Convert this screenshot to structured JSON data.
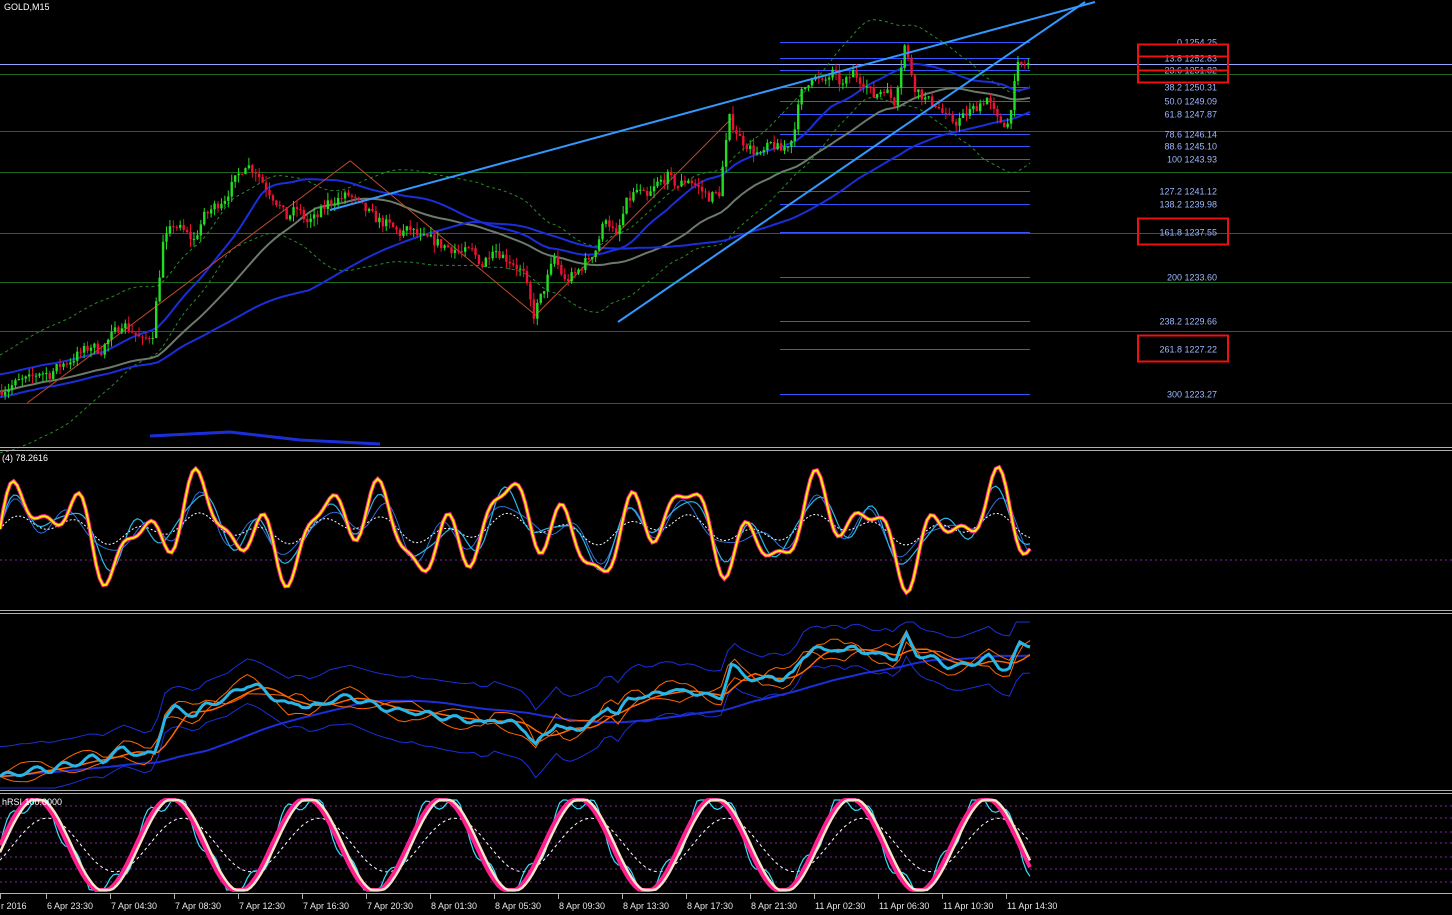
{
  "header": {
    "symbol_label": "GOLD,M15"
  },
  "panes": {
    "rsi_label": "(4) 78.2616",
    "stochrsi_label": "hRSI 100.0000"
  },
  "colors": {
    "background": "#000000",
    "candle_up": "#22dd22",
    "candle_down": "#ee1133",
    "trend_line": "#3399ff",
    "ma_blue": "#1a2fd9",
    "ma_gray": "#6b7a6b",
    "bollinger": "#2a8a2a",
    "fib_line": "#3355ff",
    "highlight_box": "#ee1111",
    "rsi_yellow": "#ffee00",
    "rsi_magenta": "#ff1f8f",
    "rsi_cyan": "#29b6e6",
    "band_orange": "#ff6600",
    "stoch_cream": "#f7e3c8",
    "stoch_cyan": "#33e0ff"
  },
  "chart_data": [
    {
      "type": "candlestick",
      "title": "GOLD,M15",
      "fib_levels": [
        {
          "ratio": "0",
          "price": 1254.25,
          "label": "0 1254.25"
        },
        {
          "ratio": "13.8",
          "price": 1252.83,
          "label": "13.8 1252.83",
          "highlighted": true
        },
        {
          "ratio": "23.6",
          "price": 1251.82,
          "label": "23.6 1251.82",
          "highlighted": true
        },
        {
          "ratio": "38.2",
          "price": 1250.31,
          "label": "38.2 1250.31"
        },
        {
          "ratio": "50.0",
          "price": 1249.09,
          "label": "50.0 1249.09"
        },
        {
          "ratio": "61.8",
          "price": 1247.87,
          "label": "61.8 1247.87"
        },
        {
          "ratio": "78.6",
          "price": 1246.14,
          "label": "78.6 1246.14"
        },
        {
          "ratio": "88.6",
          "price": 1245.1,
          "label": "88.6 1245.10"
        },
        {
          "ratio": "100",
          "price": 1243.93,
          "label": "100 1243.93"
        },
        {
          "ratio": "127.2",
          "price": 1241.12,
          "label": "127.2 1241.12"
        },
        {
          "ratio": "138.2",
          "price": 1239.98,
          "label": "138.2 1239.98"
        },
        {
          "ratio": "161.8",
          "price": 1237.55,
          "label": "161.8 1237.55",
          "highlighted": true
        },
        {
          "ratio": "200",
          "price": 1233.6,
          "label": "200 1233.60"
        },
        {
          "ratio": "238.2",
          "price": 1229.66,
          "label": "238.2 1229.66"
        },
        {
          "ratio": "261.8",
          "price": 1227.22,
          "label": "261.8 1227.22",
          "highlighted": true
        },
        {
          "ratio": "300",
          "price": 1223.27,
          "label": "300 1223.27"
        }
      ],
      "close_path": [
        [
          0,
          1223.5
        ],
        [
          3,
          1223.8
        ],
        [
          6,
          1224.4
        ],
        [
          9,
          1224.6
        ],
        [
          12,
          1225.2
        ],
        [
          15,
          1225.0
        ],
        [
          18,
          1225.8
        ],
        [
          21,
          1226.2
        ],
        [
          24,
          1226.9
        ],
        [
          27,
          1227.5
        ],
        [
          30,
          1227.1
        ],
        [
          33,
          1228.4
        ],
        [
          36,
          1229.5
        ],
        [
          39,
          1228.8
        ],
        [
          42,
          1227.9
        ],
        [
          45,
          1228.6
        ],
        [
          48,
          1236.5
        ],
        [
          51,
          1238.2
        ],
        [
          54,
          1237.6
        ],
        [
          57,
          1236.8
        ],
        [
          60,
          1238.9
        ],
        [
          63,
          1239.8
        ],
        [
          66,
          1240.5
        ],
        [
          69,
          1242.1
        ],
        [
          72,
          1243.5
        ],
        [
          75,
          1242.9
        ],
        [
          78,
          1241.5
        ],
        [
          81,
          1240.2
        ],
        [
          84,
          1238.8
        ],
        [
          87,
          1239.6
        ],
        [
          90,
          1238.4
        ],
        [
          93,
          1238.9
        ],
        [
          96,
          1240.1
        ],
        [
          99,
          1240.4
        ],
        [
          102,
          1240.8
        ],
        [
          105,
          1240.0
        ],
        [
          108,
          1239.2
        ],
        [
          111,
          1238.5
        ],
        [
          114,
          1238.1
        ],
        [
          117,
          1237.4
        ],
        [
          120,
          1237.8
        ],
        [
          123,
          1237.0
        ],
        [
          126,
          1236.9
        ],
        [
          129,
          1236.4
        ],
        [
          132,
          1236.1
        ],
        [
          135,
          1235.7
        ],
        [
          138,
          1235.9
        ],
        [
          141,
          1234.6
        ],
        [
          144,
          1236.2
        ],
        [
          147,
          1235.4
        ],
        [
          150,
          1234.8
        ],
        [
          153,
          1233.8
        ],
        [
          156,
          1230.2
        ],
        [
          159,
          1232.6
        ],
        [
          162,
          1235.3
        ],
        [
          165,
          1233.2
        ],
        [
          168,
          1233.8
        ],
        [
          171,
          1234.9
        ],
        [
          174,
          1236.0
        ],
        [
          177,
          1238.9
        ],
        [
          180,
          1237.0
        ],
        [
          183,
          1240.1
        ],
        [
          186,
          1241.2
        ],
        [
          189,
          1240.5
        ],
        [
          192,
          1241.8
        ],
        [
          195,
          1242.4
        ],
        [
          198,
          1241.6
        ],
        [
          201,
          1242.2
        ],
        [
          204,
          1241.4
        ],
        [
          207,
          1240.6
        ],
        [
          210,
          1241.0
        ],
        [
          213,
          1247.5
        ],
        [
          216,
          1245.8
        ],
        [
          219,
          1244.9
        ],
        [
          222,
          1244.2
        ],
        [
          225,
          1245.3
        ],
        [
          228,
          1244.7
        ],
        [
          231,
          1245.6
        ],
        [
          234,
          1249.8
        ],
        [
          237,
          1251.3
        ],
        [
          240,
          1250.6
        ],
        [
          243,
          1251.5
        ],
        [
          246,
          1250.4
        ],
        [
          249,
          1251.6
        ],
        [
          252,
          1250.7
        ],
        [
          255,
          1249.5
        ],
        [
          258,
          1250.2
        ],
        [
          261,
          1249.0
        ],
        [
          264,
          1253.9
        ],
        [
          267,
          1250.3
        ],
        [
          270,
          1249.2
        ],
        [
          273,
          1248.8
        ],
        [
          276,
          1247.6
        ],
        [
          279,
          1247.2
        ],
        [
          282,
          1247.9
        ],
        [
          285,
          1248.6
        ],
        [
          288,
          1249.3
        ],
        [
          291,
          1247.4
        ],
        [
          294,
          1247.0
        ],
        [
          297,
          1252.1
        ],
        [
          300,
          1252.3
        ]
      ],
      "price_range": [
        1221.0,
        1257.0
      ]
    },
    {
      "type": "line",
      "title": "(4) 78.2616",
      "ylim": [
        0,
        100
      ],
      "current_value": 78.2616
    },
    {
      "type": "line",
      "ylim": [
        0,
        100
      ]
    },
    {
      "type": "line",
      "title": "hRSI 100.0000",
      "ylim": [
        0,
        100
      ],
      "current_value": 100.0
    }
  ],
  "x_axis": {
    "ticks": [
      "r 2016",
      "6 Apr 23:30",
      "7 Apr 04:30",
      "7 Apr 08:30",
      "7 Apr 12:30",
      "7 Apr 16:30",
      "7 Apr 20:30",
      "8 Apr 01:30",
      "8 Apr 05:30",
      "8 Apr 09:30",
      "8 Apr 13:30",
      "8 Apr 17:30",
      "8 Apr 21:30",
      "11 Apr 02:30",
      "11 Apr 06:30",
      "11 Apr 10:30",
      "11 Apr 14:30"
    ]
  }
}
